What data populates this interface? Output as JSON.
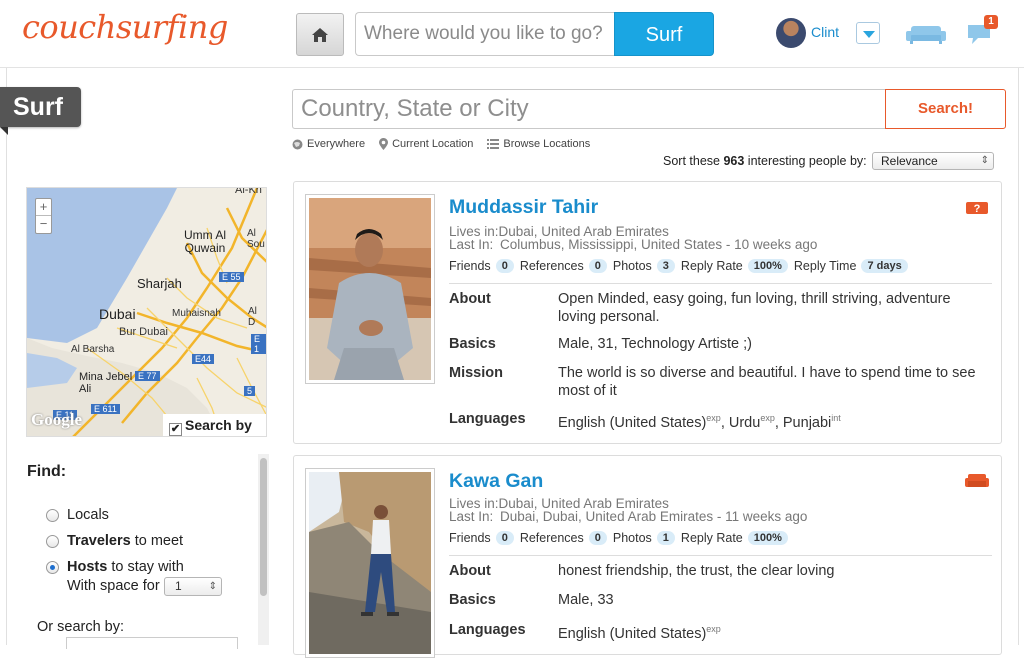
{
  "header": {
    "logo": "couchsurfing",
    "search_placeholder": "Where would you like to go?",
    "surf_button": "Surf",
    "user_name": "Clint",
    "notification_count": "1"
  },
  "sidebar": {
    "tag": "Surf",
    "map": {
      "zoom_in": "+",
      "zoom_out": "−",
      "watermark": "Google",
      "search_by_map": "Search by map",
      "search_by_map_checked": true,
      "labels": [
        "Al-Kh",
        "Umm Al Quwain",
        "Al Sou",
        "Sharjah",
        "E 55",
        "Dubai",
        "Muhaisnah",
        "Al D",
        "Bur Dubai",
        "E 1",
        "Al Barsha",
        "E44",
        "Mina Jebel Ali",
        "E 77",
        "E 611",
        "E 11",
        "5"
      ]
    },
    "find": {
      "title": "Find:",
      "options": [
        {
          "bold": "",
          "rest": "Locals",
          "selected": false
        },
        {
          "bold": "Travelers",
          "rest": " to meet",
          "selected": false
        },
        {
          "bold": "Hosts",
          "rest": " to stay with",
          "selected": true
        }
      ],
      "space_label": "With space for",
      "space_value": "1",
      "or_search": "Or search by:"
    }
  },
  "search": {
    "placeholder": "Country, State or City",
    "button": "Search!",
    "links": [
      "Everywhere",
      "Current Location",
      "Browse Locations"
    ],
    "sort_prefix": "Sort these ",
    "count": "963",
    "sort_suffix": " interesting people by:",
    "sort_value": "Relevance"
  },
  "results": [
    {
      "name": "Muddassir Tahir",
      "lives_label": "Lives in:",
      "lives_in": "Dubai, United Arab Emirates",
      "last_label": "Last In:",
      "last_in": "Columbus, Mississippi, United States - 10 weeks ago",
      "stats": {
        "friends_label": "Friends",
        "friends": "0",
        "references_label": "References",
        "references": "0",
        "photos_label": "Photos",
        "photos": "3",
        "reply_rate_label": "Reply Rate",
        "reply_rate": "100%",
        "reply_time_label": "Reply Time",
        "reply_time": "7 days"
      },
      "about_label": "About",
      "about": "Open Minded, easy going, fun loving, thrill striving, adventure loving personal.",
      "basics_label": "Basics",
      "basics": "Male, 31, Technology Artiste ;)",
      "mission_label": "Mission",
      "mission": "The world is so diverse and beautiful. I have to spend time to see most of it",
      "languages_label": "Languages",
      "languages": [
        {
          "name": "English (United States)",
          "level": "exp"
        },
        {
          "name": "Urdu",
          "level": "exp"
        },
        {
          "name": "Punjabi",
          "level": "int"
        }
      ],
      "status_icon": "maybe-couch-icon"
    },
    {
      "name": "Kawa Gan",
      "lives_label": "Lives in:",
      "lives_in": "Dubai, United Arab Emirates",
      "last_label": "Last In:",
      "last_in": "Dubai, Dubai, United Arab Emirates - 11 weeks ago",
      "stats": {
        "friends_label": "Friends",
        "friends": "0",
        "references_label": "References",
        "references": "0",
        "photos_label": "Photos",
        "photos": "1",
        "reply_rate_label": "Reply Rate",
        "reply_rate": "100%"
      },
      "about_label": "About",
      "about": "honest friendship, the trust, the clear loving",
      "basics_label": "Basics",
      "basics": "Male, 33",
      "languages_label": "Languages",
      "languages": [
        {
          "name": "English (United States)",
          "level": "exp"
        }
      ],
      "status_icon": "couch-icon"
    }
  ],
  "colors": {
    "brand_orange": "#e8592b",
    "link_blue": "#1a8ccc",
    "button_blue": "#1aa6e3"
  }
}
